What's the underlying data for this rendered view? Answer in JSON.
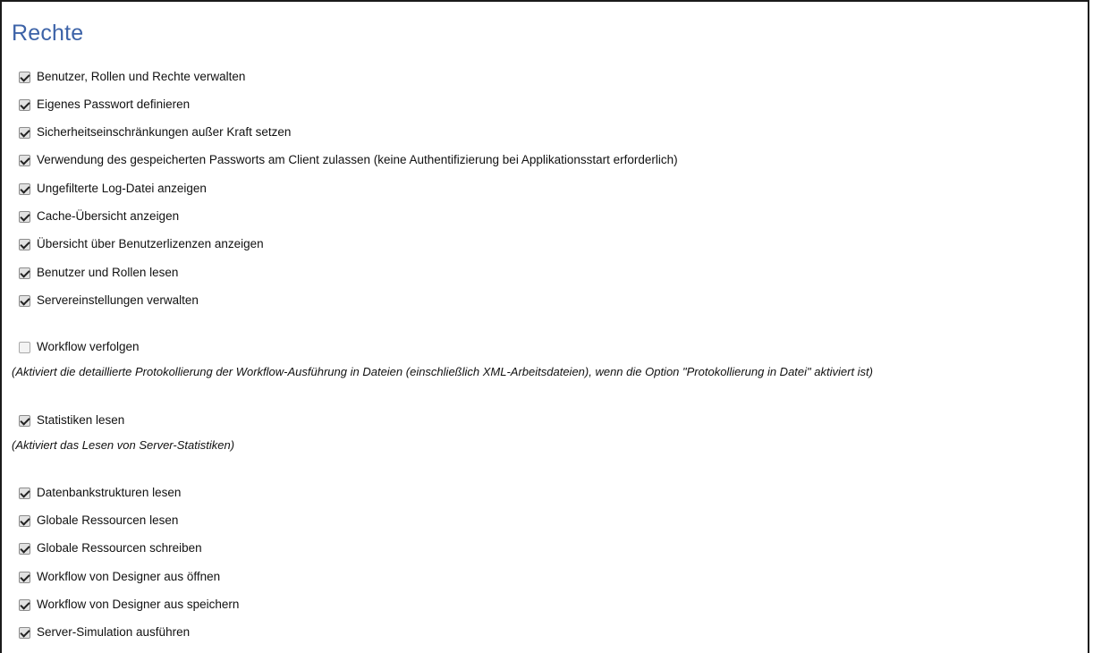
{
  "section": {
    "title": "Rechte"
  },
  "permissions": [
    {
      "label": "Benutzer, Rollen und Rechte verwalten",
      "checked": true
    },
    {
      "label": "Eigenes Passwort definieren",
      "checked": true
    },
    {
      "label": "Sicherheitseinschränkungen außer Kraft setzen",
      "checked": true
    },
    {
      "label": "Verwendung des gespeicherten Passworts am Client zulassen (keine Authentifizierung bei Applikationsstart erforderlich)",
      "checked": true
    },
    {
      "label": "Ungefilterte Log-Datei anzeigen",
      "checked": true
    },
    {
      "label": "Cache-Übersicht anzeigen",
      "checked": true
    },
    {
      "label": "Übersicht über Benutzerlizenzen anzeigen",
      "checked": true
    },
    {
      "label": "Benutzer und Rollen lesen",
      "checked": true
    },
    {
      "label": "Servereinstellungen verwalten",
      "checked": true
    },
    {
      "label": "Workflow verfolgen",
      "checked": false
    },
    {
      "label": "Statistiken lesen",
      "checked": true
    },
    {
      "label": "Datenbankstrukturen lesen",
      "checked": true
    },
    {
      "label": "Globale Ressourcen lesen",
      "checked": true
    },
    {
      "label": "Globale Ressourcen schreiben",
      "checked": true
    },
    {
      "label": "Workflow von Designer aus öffnen",
      "checked": true
    },
    {
      "label": "Workflow von Designer aus speichern",
      "checked": true
    },
    {
      "label": "Server-Simulation ausführen",
      "checked": true
    }
  ],
  "notes": {
    "workflow_trace": "(Aktiviert die detaillierte Protokollierung der Workflow-Ausführung in Dateien (einschließlich XML-Arbeitsdateien), wenn die Option \"Protokollierung in Datei\" aktiviert ist)",
    "statistics": "(Aktiviert das Lesen von Server-Statistiken)"
  }
}
